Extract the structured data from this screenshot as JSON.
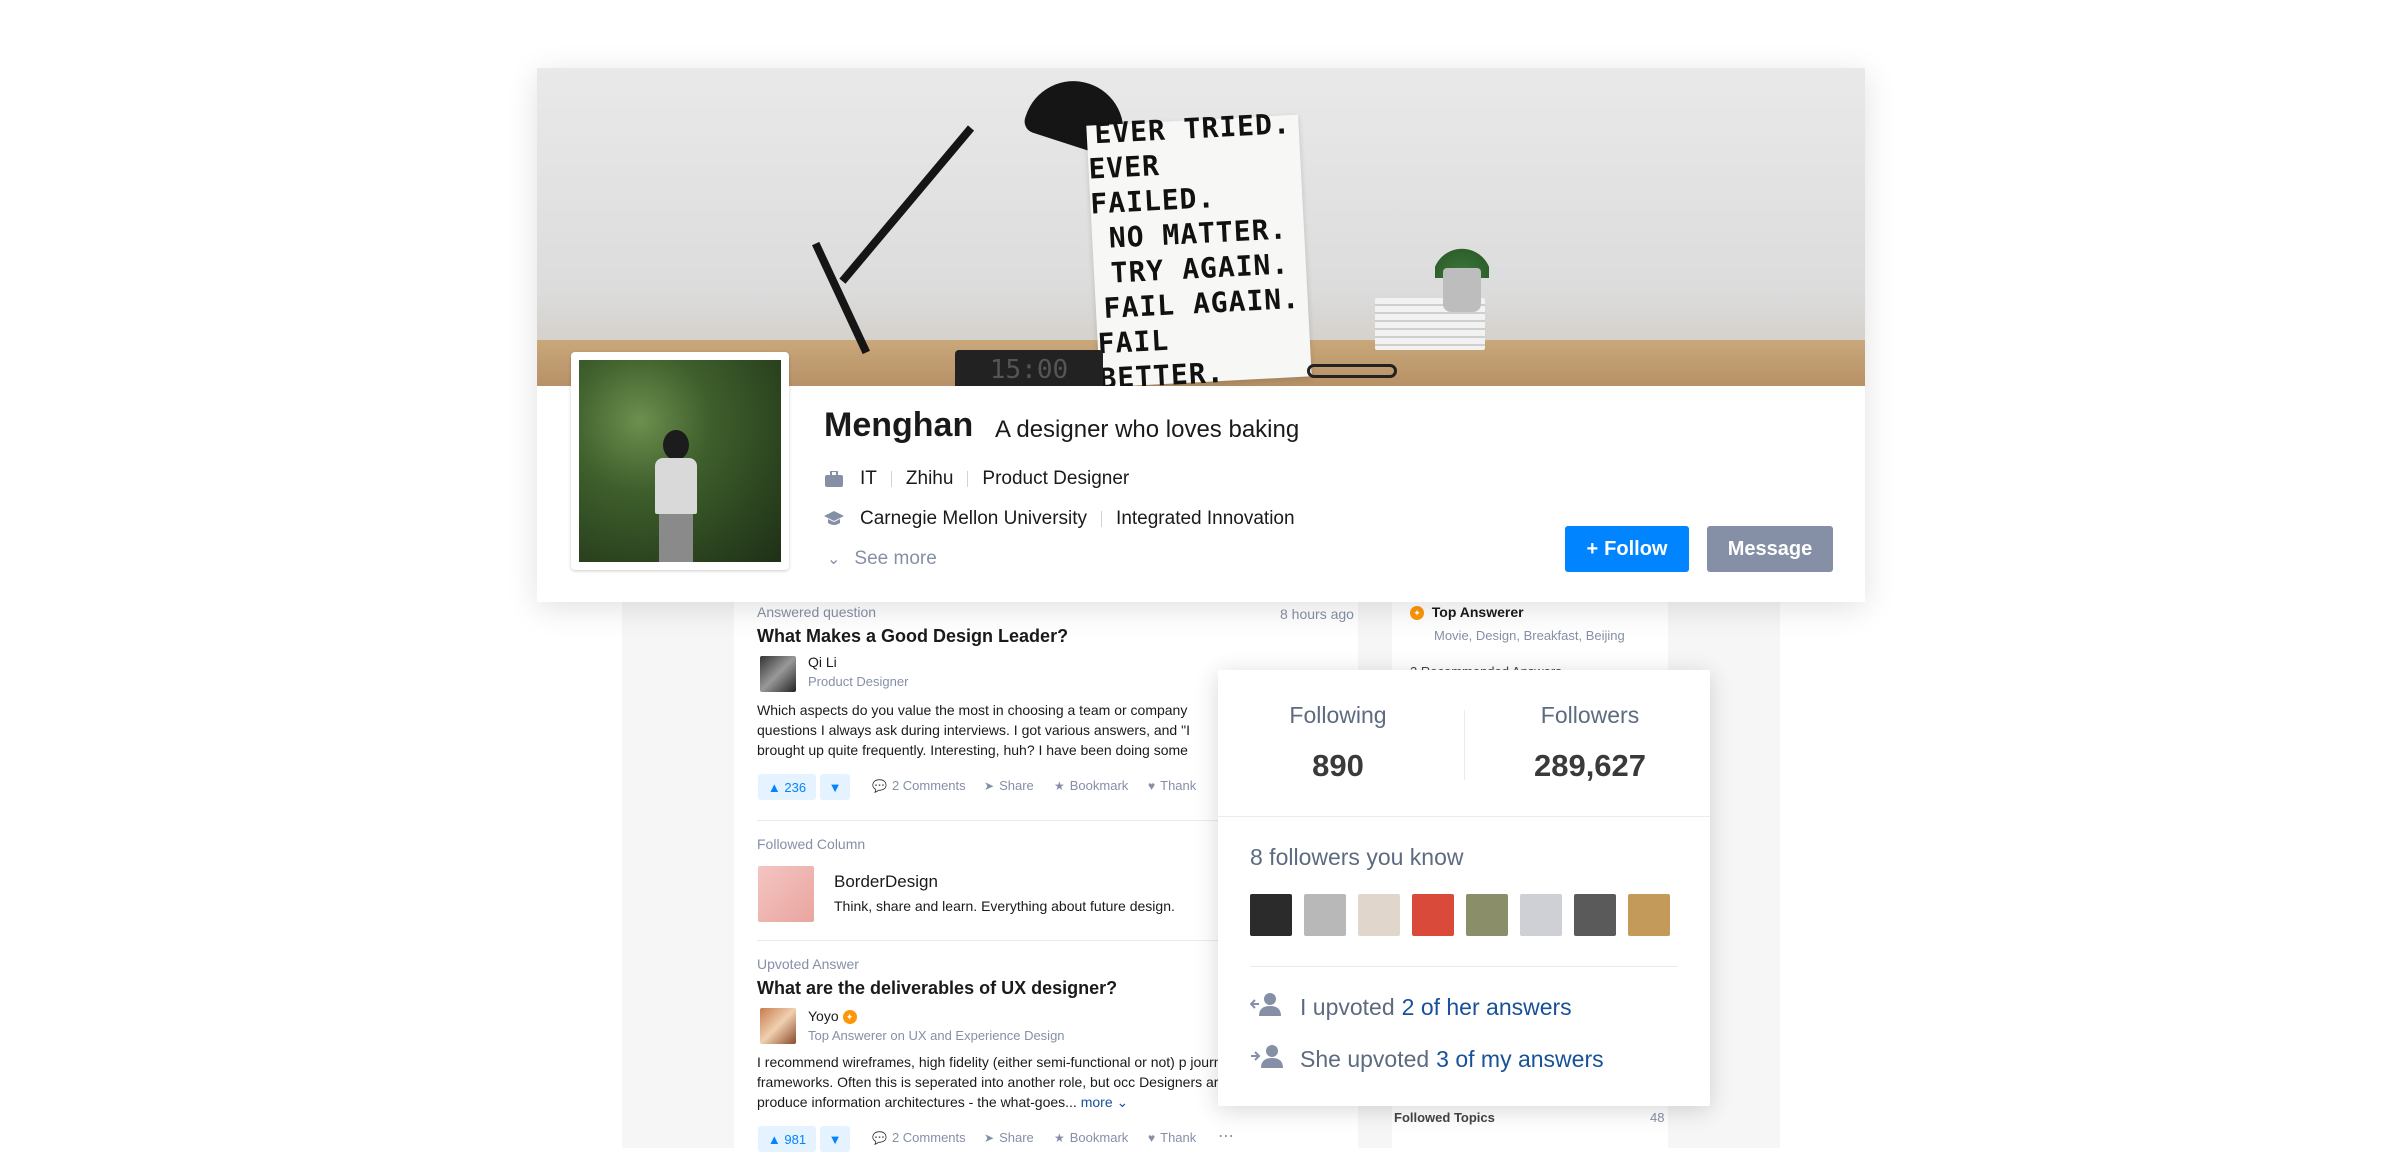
{
  "profile": {
    "name": "Menghan",
    "headline": "A designer who loves baking",
    "industry": "IT",
    "company": "Zhihu",
    "position": "Product Designer",
    "school": "Carnegie Mellon University",
    "major": "Integrated Innovation",
    "see_more": "See more",
    "follow_label": "Follow",
    "message_label": "Message",
    "cover_poster_lines": [
      "EVER TRIED.",
      "EVER FAILED.",
      "NO MATTER.",
      "TRY AGAIN.",
      "FAIL AGAIN.",
      "FAIL BETTER."
    ],
    "cover_clock": "15:00"
  },
  "popup": {
    "following_label": "Following",
    "following_count": "890",
    "followers_label": "Followers",
    "followers_count": "289,627",
    "known_title": "8 followers you know",
    "known_avatar_colors": [
      "#2b2b2b",
      "#b8b8b8",
      "#e0d6cc",
      "#d94a3a",
      "#8a8f6a",
      "#cfcfd6",
      "#5a5a5a",
      "#c49a5a"
    ],
    "upvoted_prefix": "I upvoted",
    "upvoted_link": "2 of her answers",
    "she_upvoted_prefix": "She upvoted",
    "she_upvoted_link": "3 of my answers"
  },
  "feed": {
    "item1": {
      "label": "Answered question",
      "time": "8 hours ago",
      "title": "What Makes a Good Design Leader?",
      "author": "Qi Li",
      "author_headline": "Product Designer",
      "excerpt": "Which aspects do you value the most in choosing a team or company questions I always ask during interviews. I got various answers, and \"I brought up quite frequently. Interesting, huh? I have been doing some",
      "upvotes": "236",
      "comments": "2 Comments",
      "share": "Share",
      "bookmark": "Bookmark",
      "thank": "Thank"
    },
    "item2": {
      "label": "Followed Column",
      "title": "BorderDesign",
      "description": "Think, share and learn. Everything about future design."
    },
    "item3": {
      "label": "Upvoted Answer",
      "title": "What are the deliverables of UX designer?",
      "author": "Yoyo",
      "author_headline": "Top Answerer on UX and Experience Design",
      "excerpt": "I recommend wireframes, high fidelity (either semi-functional or not) p journey frameworks. Often this is seperated into another role, but occ Designers are asked to produce information architectures - the what-goes...",
      "more": "more",
      "upvotes": "981",
      "comments": "2 Comments",
      "share": "Share",
      "bookmark": "Bookmark",
      "thank": "Thank"
    }
  },
  "sidebar": {
    "top_answerer_title": "Top Answerer",
    "top_answerer_topics": "Movie, Design, Breakfast, Beijing",
    "recommended_partial": "2 Recommended Answers",
    "followed_topics_label": "Followed Topics",
    "followed_topics_count": "48"
  },
  "colors": {
    "brand_blue": "#0084ff",
    "link_blue": "#175199",
    "muted_gray": "#8590a6"
  }
}
